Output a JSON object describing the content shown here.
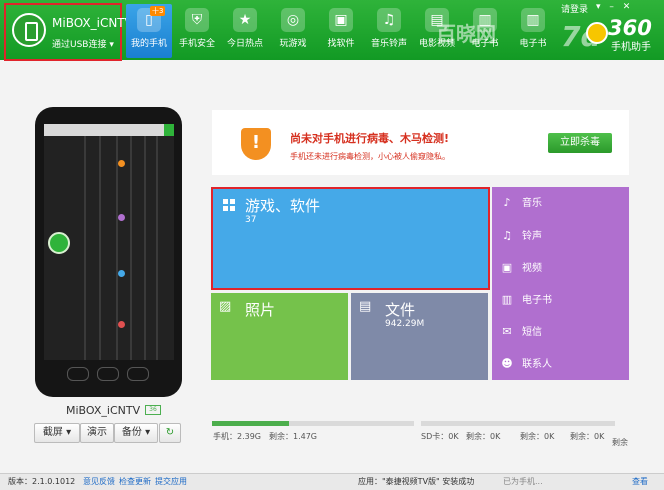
{
  "device": {
    "name": "MiBOX_iCNTV",
    "connection": "通过USB连接"
  },
  "nav": [
    {
      "label": "我的手机",
      "badge": "十3",
      "icon": "phone-icon"
    },
    {
      "label": "手机安全",
      "icon": "shield-icon"
    },
    {
      "label": "今日热点",
      "icon": "star-icon"
    },
    {
      "label": "玩游戏",
      "icon": "gamepad-icon"
    },
    {
      "label": "找软件",
      "icon": "bag-icon"
    },
    {
      "label": "音乐铃声",
      "icon": "music-icon"
    },
    {
      "label": "电影视频",
      "icon": "film-icon"
    },
    {
      "label": "电子书",
      "icon": "book-icon"
    },
    {
      "label": "电子书",
      "icon": "book-icon"
    }
  ],
  "header": {
    "login": "请登录",
    "logo_num": "360",
    "logo_text": "手机助手",
    "watermark": "百晓网",
    "watermark2": "7d"
  },
  "banner": {
    "title": "尚未对手机进行病毒、木马检测!",
    "subtitle": "手机还未进行病毒检测，小心被人偷窥隐私。",
    "button": "立即杀毒"
  },
  "tiles": {
    "games": {
      "title": "游戏、软件",
      "count": "37"
    },
    "photos": {
      "title": "照片"
    },
    "files": {
      "title": "文件",
      "size": "942.29M"
    }
  },
  "media_menu": [
    {
      "label": "音乐",
      "icon": "music-note-icon"
    },
    {
      "label": "铃声",
      "icon": "bell-icon"
    },
    {
      "label": "视频",
      "icon": "video-icon"
    },
    {
      "label": "电子书",
      "icon": "ebook-icon"
    },
    {
      "label": "短信",
      "icon": "mail-icon"
    },
    {
      "label": "联系人",
      "icon": "contact-icon"
    }
  ],
  "phone_panel": {
    "label": "MiBOX_iCNTV",
    "battery": "36",
    "buttons": {
      "screenshot": "截屏",
      "demo": "演示",
      "backup": "备份"
    }
  },
  "storage": {
    "phone": "手机：2.39G",
    "phone_remain": "剩余：1.47G",
    "phone_fill": 0.38,
    "sd": "SD卡：0K",
    "sd_remain": "剩余：0K",
    "sd2": "剩余：0K",
    "sd3": "剩余：0K",
    "tail": "剩余"
  },
  "status": {
    "version": "版本：2.1.0.1012",
    "feedback": "意见反馈",
    "update": "检查更新",
    "suggest": "提交应用",
    "app_msg": "应用：\"泰捷视频TV版\" 安装成功",
    "right": "已为手机...",
    "right2": "查看"
  },
  "colors": {
    "green": "#2fb33a",
    "blue": "#45a9e8",
    "lightgreen": "#75c24b",
    "slate": "#7f8aa8",
    "purple": "#b06fcf"
  }
}
